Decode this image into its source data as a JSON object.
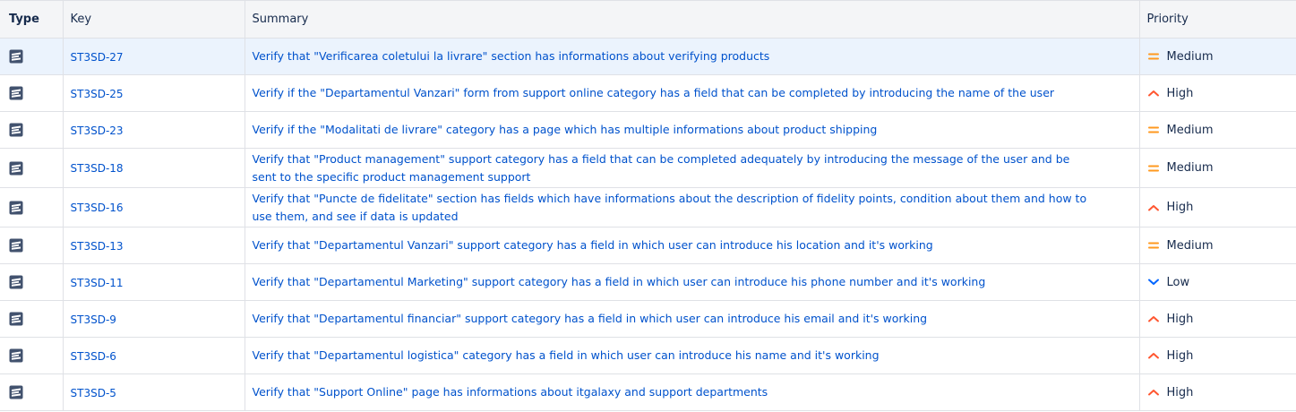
{
  "columns": {
    "type": "Type",
    "key": "Key",
    "summary": "Summary",
    "priority": "Priority"
  },
  "colors": {
    "medium": "#ff991f",
    "high": "#ff5630",
    "low": "#0065ff",
    "link": "#0052cc"
  },
  "rows": [
    {
      "type_icon": "test-issue-icon",
      "key": "ST3SD-27",
      "summary": "Verify that \"Verificarea coletului la livrare\" section has informations about verifying products",
      "priority": "Medium",
      "priority_icon": "medium-priority-icon"
    },
    {
      "type_icon": "test-issue-icon",
      "key": "ST3SD-25",
      "summary": "Verify if the \"Departamentul Vanzari\" form from support online category has a field that can be completed by introducing the name of the user",
      "priority": "High",
      "priority_icon": "high-priority-icon"
    },
    {
      "type_icon": "test-issue-icon",
      "key": "ST3SD-23",
      "summary": "Verify if the \"Modalitati de livrare\" category has a page which has multiple informations about product shipping",
      "priority": "Medium",
      "priority_icon": "medium-priority-icon"
    },
    {
      "type_icon": "test-issue-icon",
      "key": "ST3SD-18",
      "summary": "Verify that \"Product management\" support category has a field that can be completed adequately by introducing the message of the user and be sent to the specific product management support",
      "priority": "Medium",
      "priority_icon": "medium-priority-icon"
    },
    {
      "type_icon": "test-issue-icon",
      "key": "ST3SD-16",
      "summary": "Verify that \"Puncte de fidelitate\" section has fields which have informations about the description of fidelity points, condition about them and how to use them, and see if data is updated",
      "priority": "High",
      "priority_icon": "high-priority-icon"
    },
    {
      "type_icon": "test-issue-icon",
      "key": "ST3SD-13",
      "summary": "Verify that \"Departamentul Vanzari\" support category has a field in which user can introduce his location and it's working",
      "priority": "Medium",
      "priority_icon": "medium-priority-icon"
    },
    {
      "type_icon": "test-issue-icon",
      "key": "ST3SD-11",
      "summary": "Verify that \"Departamentul Marketing\" support category has a field in which user can introduce his phone number and it's working",
      "priority": "Low",
      "priority_icon": "low-priority-icon"
    },
    {
      "type_icon": "test-issue-icon",
      "key": "ST3SD-9",
      "summary": "Verify that \"Departamentul financiar\" support category has a field in which user can introduce his email and it's working",
      "priority": "High",
      "priority_icon": "high-priority-icon"
    },
    {
      "type_icon": "test-issue-icon",
      "key": "ST3SD-6",
      "summary": "Verify that \"Departamentul logistica\" category has a field in which user can introduce his name and it's working",
      "priority": "High",
      "priority_icon": "high-priority-icon"
    },
    {
      "type_icon": "test-issue-icon",
      "key": "ST3SD-5",
      "summary": "Verify that \"Support Online\" page has informations about itgalaxy and support departments",
      "priority": "High",
      "priority_icon": "high-priority-icon"
    }
  ]
}
